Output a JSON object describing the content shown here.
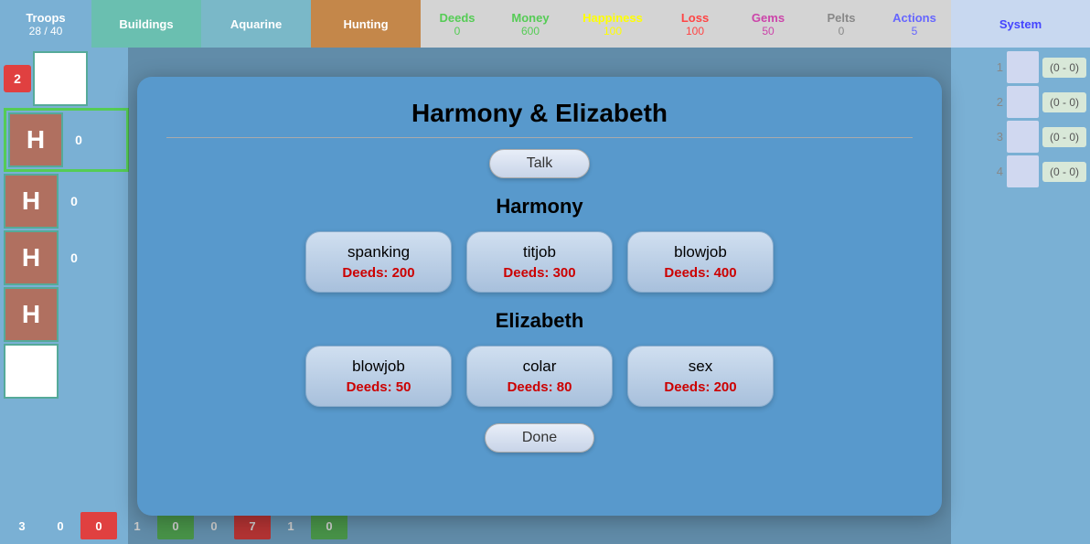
{
  "topbar": {
    "troops": {
      "label": "Troops",
      "sub": "28 / 40"
    },
    "buildings": {
      "label": "Buildings"
    },
    "aquarine": {
      "label": "Aquarine"
    },
    "hunting": {
      "label": "Hunting"
    },
    "deeds": {
      "label": "Deeds",
      "value": "0"
    },
    "money": {
      "label": "Money",
      "value": "600"
    },
    "happiness": {
      "label": "Happiness",
      "value": "100"
    },
    "loss": {
      "label": "Loss",
      "value": "100"
    },
    "gems": {
      "label": "Gems",
      "value": "50"
    },
    "pelts": {
      "label": "Pelts",
      "value": "0"
    },
    "actions": {
      "label": "Actions",
      "value": "5"
    },
    "system": {
      "label": "System"
    }
  },
  "modal": {
    "title": "Harmony & Elizabeth",
    "talk_button": "Talk",
    "done_button": "Done",
    "harmony_label": "Harmony",
    "elizabeth_label": "Elizabeth",
    "harmony_actions": [
      {
        "name": "spanking",
        "cost": "Deeds: 200"
      },
      {
        "name": "titjob",
        "cost": "Deeds: 300"
      },
      {
        "name": "blowjob",
        "cost": "Deeds: 400"
      }
    ],
    "elizabeth_actions": [
      {
        "name": "blowjob",
        "cost": "Deeds: 50"
      },
      {
        "name": "colar",
        "cost": "Deeds: 80"
      },
      {
        "name": "sex",
        "cost": "Deeds: 200"
      }
    ]
  },
  "sidebar_left": {
    "items": [
      {
        "badge": "2",
        "type": "red"
      },
      {
        "avatar": "H",
        "badge": "0",
        "type": "zero"
      },
      {
        "avatar": "H",
        "badge": "0",
        "type": "zero"
      },
      {
        "avatar": "H",
        "badge": "0",
        "type": "zero"
      },
      {
        "avatar": "H",
        "badge": "",
        "type": "zero"
      }
    ]
  },
  "right_panel": {
    "rows": [
      {
        "num": "1",
        "range": "(0 - 0)"
      },
      {
        "num": "2",
        "range": "(0 - 0)"
      },
      {
        "num": "3",
        "range": "(0 - 0)"
      },
      {
        "num": "4",
        "range": "(0 - 0)"
      }
    ]
  },
  "bottom": {
    "cells": [
      {
        "val": "3",
        "color": "#7ab0d4"
      },
      {
        "val": "0",
        "color": "#7ab0d4"
      },
      {
        "val": "0",
        "color": "#e04040"
      },
      {
        "val": "1",
        "color": "#7ab0d4"
      },
      {
        "val": "0",
        "color": "#5ab85a"
      },
      {
        "val": "0",
        "color": "#7ab0d4"
      },
      {
        "val": "7",
        "color": "#e04040"
      },
      {
        "val": "1",
        "color": "#7ab0d4"
      },
      {
        "val": "0",
        "color": "#5ab85a"
      }
    ]
  },
  "colors": {
    "accent_red": "#cc0000",
    "modal_bg": "#5899cc",
    "btn_bg": "#c8d4e8"
  }
}
